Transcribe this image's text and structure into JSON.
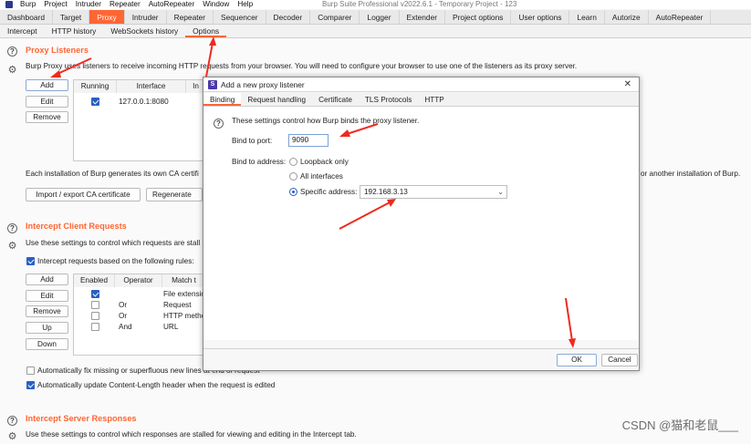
{
  "menubar": {
    "items": [
      "Burp",
      "Project",
      "Intruder",
      "Repeater",
      "AutoRepeater",
      "Window",
      "Help"
    ],
    "window_title": "Burp Suite Professional v2022.6.1 - Temporary Project - 123"
  },
  "main_tabs": [
    "Dashboard",
    "Target",
    "Proxy",
    "Intruder",
    "Repeater",
    "Sequencer",
    "Decoder",
    "Comparer",
    "Logger",
    "Extender",
    "Project options",
    "User options",
    "Learn",
    "Autorize",
    "AutoRepeater"
  ],
  "proxy_tabs": [
    "Intercept",
    "HTTP history",
    "WebSockets history",
    "Options"
  ],
  "proxy_listeners": {
    "title": "Proxy Listeners",
    "description": "Burp Proxy uses listeners to receive incoming HTTP requests from your browser. You will need to configure your browser to use one of the listeners as its proxy server.",
    "buttons": [
      "Add",
      "Edit",
      "Remove"
    ],
    "columns": [
      "Running",
      "Interface",
      "In"
    ],
    "rows": [
      {
        "interface": "127.0.0.1:8080"
      }
    ],
    "ca_text_left": "Each installation of Burp generates its own CA certifi",
    "ca_text_right": "or another installation of Burp.",
    "ca_buttons": [
      "Import / export CA certificate",
      "Regenerate CA"
    ]
  },
  "intercept_client": {
    "title": "Intercept Client Requests",
    "description": "Use these settings to control which requests are stall",
    "checkbox_label": "Intercept requests based on the following rules:",
    "buttons": [
      "Add",
      "Edit",
      "Remove",
      "Up",
      "Down"
    ],
    "columns": [
      "Enabled",
      "Operator",
      "Match t"
    ],
    "rows": [
      {
        "operator": "",
        "match": "File extensio"
      },
      {
        "operator": "Or",
        "match": "Request"
      },
      {
        "operator": "Or",
        "match": "HTTP metho"
      },
      {
        "operator": "And",
        "match": "URL"
      }
    ],
    "fix_newlines": "Automatically fix missing or superfluous new lines at end of request",
    "update_length": "Automatically update Content-Length header when the request is edited"
  },
  "intercept_server": {
    "title": "Intercept Server Responses",
    "description": "Use these settings to control which responses are stalled for viewing and editing in the Intercept tab."
  },
  "dialog": {
    "title": "Add a new proxy listener",
    "tabs": [
      "Binding",
      "Request handling",
      "Certificate",
      "TLS Protocols",
      "HTTP"
    ],
    "help_text": "These settings control how Burp binds the proxy listener.",
    "port_label": "Bind to port:",
    "port_value": "9090",
    "address_label": "Bind to address:",
    "options": [
      "Loopback only",
      "All interfaces",
      "Specific address:"
    ],
    "specific_address": "192.168.3.13",
    "ok_label": "OK",
    "cancel_label": "Cancel"
  },
  "watermark": "CSDN @猫和老鼠___",
  "colors": {
    "accent": "#ff6633",
    "arrow": "#ee2a1e",
    "checkbox": "#2b5fc4"
  }
}
